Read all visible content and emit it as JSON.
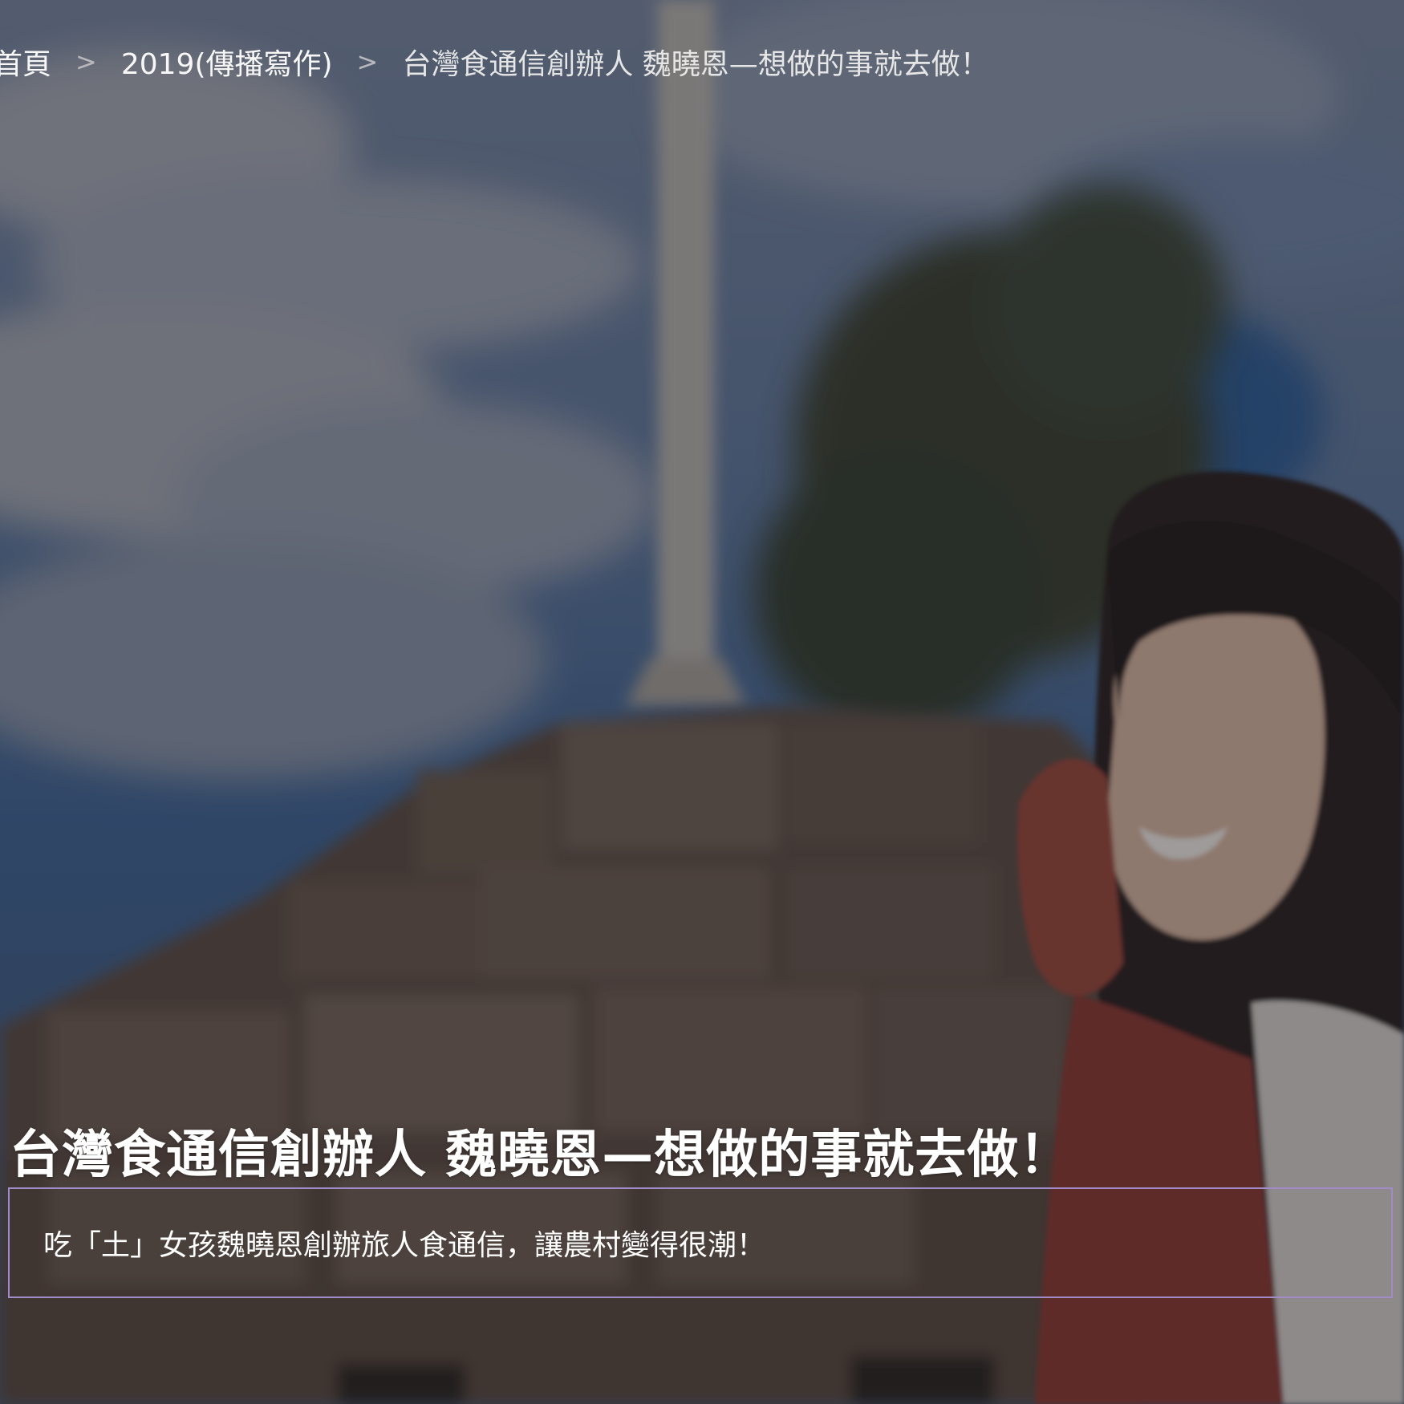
{
  "breadcrumb": {
    "home": "首頁",
    "separator": ">",
    "category": "2019(傳播寫作)",
    "current": "台灣食通信創辦人 魏曉恩—想做的事就去做！"
  },
  "article": {
    "title": "台灣食通信創辦人 魏曉恩—想做的事就去做！",
    "summary": "吃「土」女孩魏曉恩創辦旅人食通信，讓農村變得很潮！"
  },
  "theme": {
    "summary_border": "#a28cc7",
    "text": "#ffffff"
  }
}
